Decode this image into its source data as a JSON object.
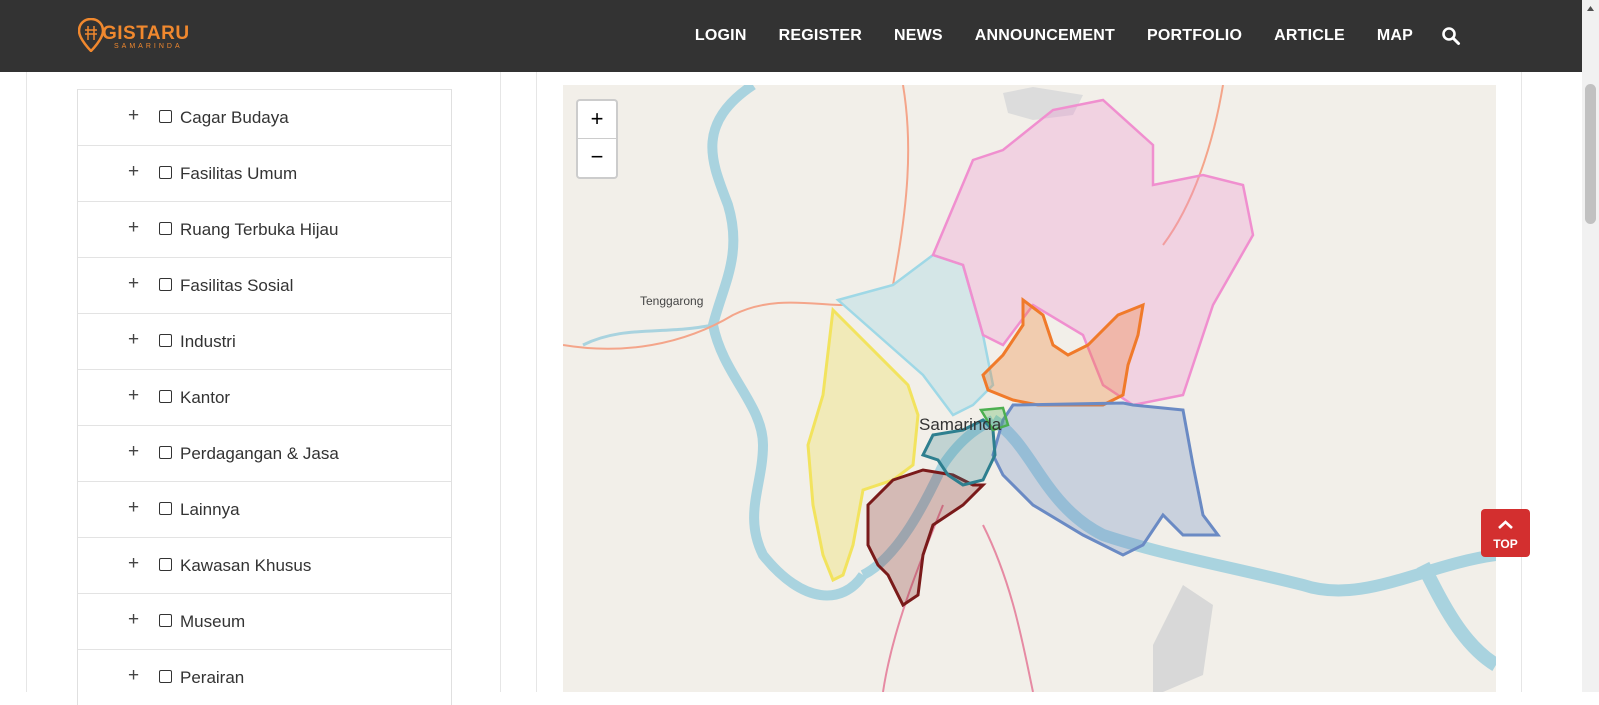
{
  "header": {
    "logo": {
      "brand": "GISTARU",
      "subtitle": "SAMARINDA"
    },
    "nav": [
      "LOGIN",
      "REGISTER",
      "NEWS",
      "ANNOUNCEMENT",
      "PORTFOLIO",
      "ARTICLE",
      "MAP"
    ],
    "search_icon": "search-icon"
  },
  "sidebar": {
    "layers": [
      {
        "label": "Cagar Budaya"
      },
      {
        "label": "Fasilitas Umum"
      },
      {
        "label": "Ruang Terbuka Hijau"
      },
      {
        "label": "Fasilitas Sosial"
      },
      {
        "label": "Industri"
      },
      {
        "label": "Kantor"
      },
      {
        "label": "Perdagangan & Jasa"
      },
      {
        "label": "Lainnya"
      },
      {
        "label": "Kawasan Khusus"
      },
      {
        "label": "Museum"
      },
      {
        "label": "Perairan"
      }
    ],
    "expand_symbol": "+"
  },
  "map": {
    "zoom_in": "+",
    "zoom_out": "−",
    "labels": {
      "town": "Tenggarong",
      "city": "Samarinda"
    },
    "district_colors": [
      "#f08fcf",
      "#9fd8e6",
      "#f2e35e",
      "#f07a2a",
      "#6a8ac4",
      "#7a1a1a",
      "#2e7f8f",
      "#4caf50"
    ]
  },
  "scroll_top": {
    "label": "TOP"
  }
}
